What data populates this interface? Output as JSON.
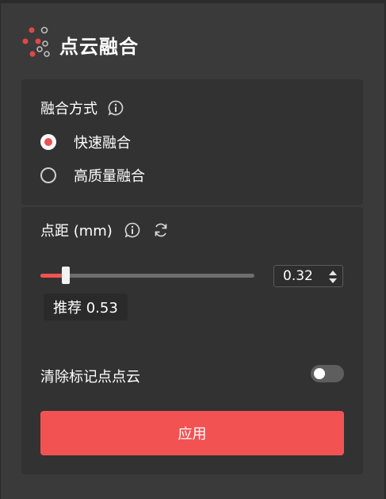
{
  "header": {
    "title": "点云融合",
    "logo_icon": "point-cloud-icon"
  },
  "fusion": {
    "label": "融合方式",
    "options": [
      {
        "label": "快速融合",
        "selected": true
      },
      {
        "label": "高质量融合",
        "selected": false
      }
    ]
  },
  "point_spacing": {
    "label": "点距 (mm)",
    "value": "0.32",
    "slider_fraction": 0.12,
    "recommend": "推荐 0.53"
  },
  "clear_markers": {
    "label": "清除标记点点云",
    "enabled": false
  },
  "apply_button": {
    "label": "应用"
  },
  "colors": {
    "accent": "#f25252",
    "background": "#3a3a3a",
    "card": "#323232"
  }
}
